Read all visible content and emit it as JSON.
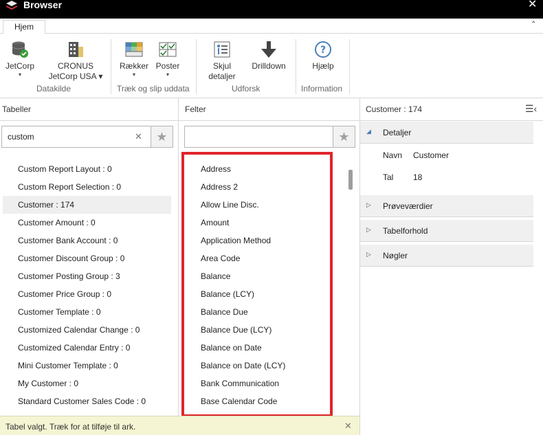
{
  "window": {
    "title": "Browser",
    "close_glyph": "✕"
  },
  "tabs": [
    {
      "label": "Hjem"
    }
  ],
  "ribbon": {
    "jetcorp": {
      "label": "JetCorp"
    },
    "cronus": {
      "line1": "CRONUS",
      "line2": "JetCorp USA ▾"
    },
    "datakilde": "Datakilde",
    "raekker": {
      "label": "Rækker"
    },
    "poster": {
      "label": "Poster"
    },
    "traek": "Træk og slip uddata",
    "skjul": {
      "line1": "Skjul",
      "line2": "detaljer"
    },
    "drilldown": {
      "label": "Drilldown"
    },
    "udforsk": "Udforsk",
    "hjaelp": {
      "label": "Hjælp"
    },
    "information": "Information"
  },
  "tables_pane": {
    "header": "Tabeller",
    "search_value": "custom",
    "items": [
      "Custom Report Layout : 0",
      "Custom Report Selection : 0",
      "Customer : 174",
      "Customer Amount : 0",
      "Customer Bank Account : 0",
      "Customer Discount Group : 0",
      "Customer Posting Group : 3",
      "Customer Price Group : 0",
      "Customer Template : 0",
      "Customized Calendar Change : 0",
      "Customized Calendar Entry : 0",
      "Mini Customer Template : 0",
      "My Customer : 0",
      "Standard Customer Sales Code : 0"
    ]
  },
  "fields_pane": {
    "header": "Felter",
    "search_value": "",
    "items": [
      "Address",
      "Address 2",
      "Allow Line Disc.",
      "Amount",
      "Application Method",
      "Area Code",
      "Balance",
      "Balance (LCY)",
      "Balance Due",
      "Balance Due (LCY)",
      "Balance on Date",
      "Balance on Date (LCY)",
      "Bank Communication",
      "Base Calendar Code"
    ]
  },
  "details_pane": {
    "header": "Customer : 174",
    "details_label": "Detaljer",
    "navn_key": "Navn",
    "navn_value": "Customer",
    "tal_key": "Tal",
    "tal_value": "18",
    "sections": [
      "Prøveværdier",
      "Tabelforhold",
      "Nøgler"
    ]
  },
  "status": {
    "message": "Tabel valgt. Træk for at tilføje til ark."
  },
  "colors": {
    "highlight": "#e0242c",
    "titlebar": "#000000"
  }
}
